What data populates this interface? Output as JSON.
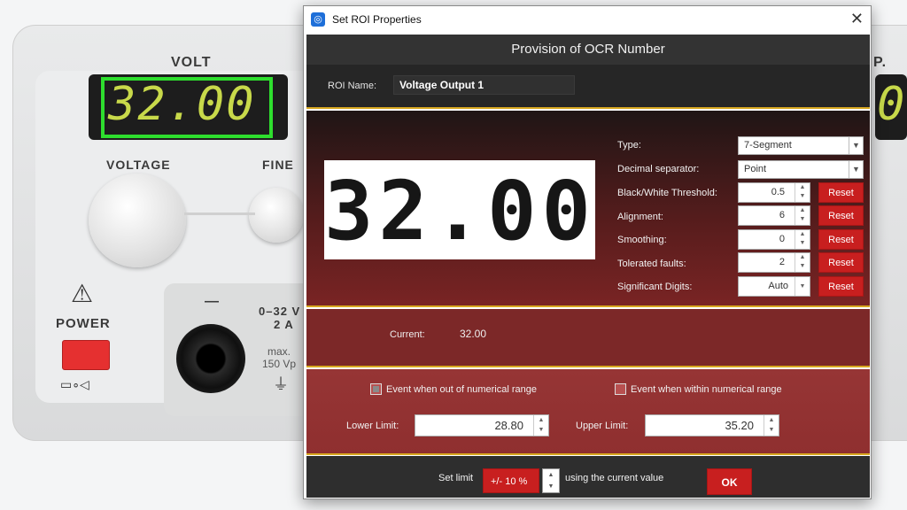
{
  "background": {
    "volt_label": "VOLT",
    "display_value": "32.00",
    "voltage_label": "VOLTAGE",
    "fine_label": "FINE",
    "power_label": "POWER",
    "range_label": "0–32 V",
    "amp_label": "2 A",
    "max_label": "max.",
    "vp_label": "150 Vp",
    "minus_label": "—",
    "right_digit": "0",
    "right_letter": "P."
  },
  "dialog": {
    "title": "Set ROI Properties",
    "header": "Provision of OCR Number",
    "roi_name_label": "ROI Name:",
    "roi_name_value": "Voltage Output 1",
    "preview_digits": "32.00",
    "props": {
      "type_label": "Type:",
      "type_value": "7-Segment",
      "decimal_label": "Decimal separator:",
      "decimal_value": "Point",
      "threshold_label": "Black/White Threshold:",
      "threshold_value": "0.5",
      "alignment_label": "Alignment:",
      "alignment_value": "6",
      "smoothing_label": "Smoothing:",
      "smoothing_value": "0",
      "faults_label": "Tolerated faults:",
      "faults_value": "2",
      "digits_label": "Significant Digits:",
      "digits_value": "Auto",
      "reset_label": "Reset"
    },
    "current_label": "Current:",
    "current_value": "32.00",
    "event_out_label": "Event when out of numerical range",
    "event_within_label": "Event when within numerical range",
    "lower_label": "Lower Limit:",
    "lower_value": "28.80",
    "upper_label": "Upper Limit:",
    "upper_value": "35.20",
    "set_limit_label": "Set limit",
    "pm_value": "+/-  10 %",
    "using_label": "using the current value",
    "ok_label": "OK"
  }
}
